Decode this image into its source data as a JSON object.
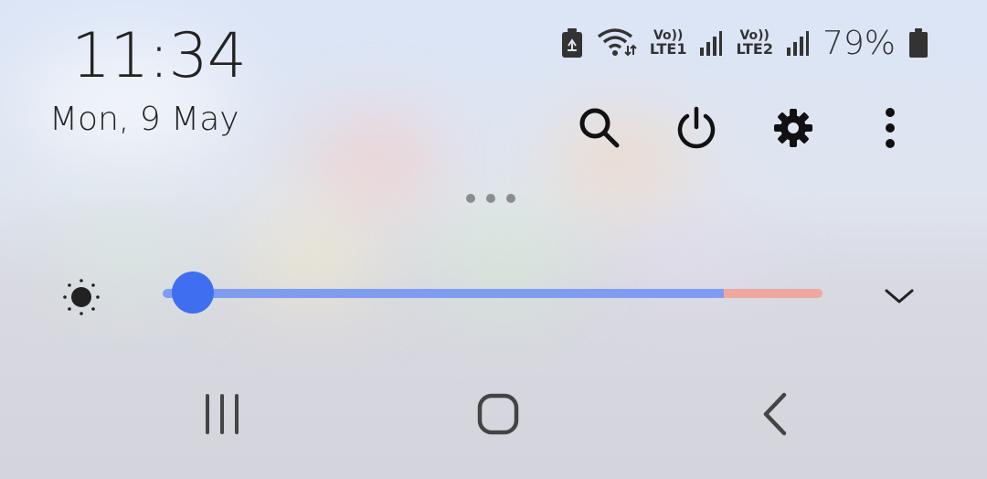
{
  "status_bar": {
    "time": "11:34",
    "date": "Mon, 9 May",
    "sim1_vo": "Vo))",
    "sim1_label": "LTE1",
    "sim2_vo": "Vo))",
    "sim2_label": "LTE2",
    "battery_percent": "79%"
  },
  "quick_actions": [
    "search-icon",
    "power-icon",
    "gear-icon",
    "more-vertical-icon"
  ],
  "brightness": {
    "level": 0.04,
    "extra_brightness_start": 0.85,
    "colors": {
      "track": "#7f9cf0",
      "extra": "#efa8a0",
      "thumb": "#3f6ff0"
    }
  },
  "navigation": [
    "recent-apps-icon",
    "home-icon",
    "back-icon"
  ]
}
